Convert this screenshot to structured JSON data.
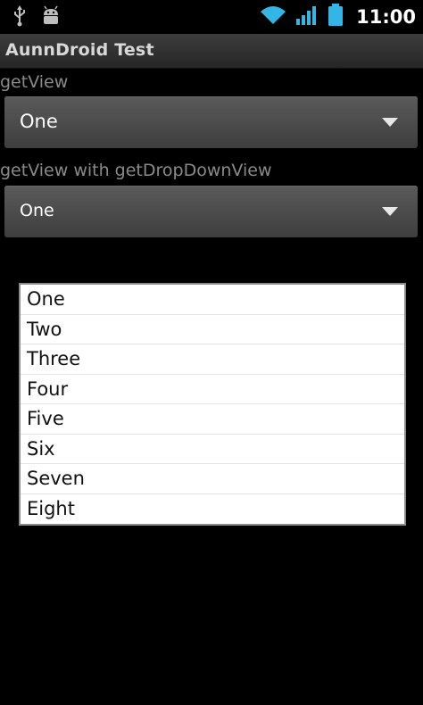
{
  "status_bar": {
    "time": "11:00",
    "icons": [
      "usb-icon",
      "android-debug-icon",
      "wifi-icon",
      "signal-icon",
      "battery-icon"
    ]
  },
  "app": {
    "title": "AunnDroid Test"
  },
  "spinner1": {
    "label": "getView",
    "selected": "One"
  },
  "spinner2": {
    "label": "getView with  getDropDownView",
    "selected": "One"
  },
  "dropdown": {
    "items": [
      "One",
      "Two",
      "Three",
      "Four",
      "Five",
      "Six",
      "Seven",
      "Eight"
    ]
  },
  "colors": {
    "background": "#000000",
    "status_icons": "#33b5e5",
    "label_text": "#8a8a8a"
  }
}
